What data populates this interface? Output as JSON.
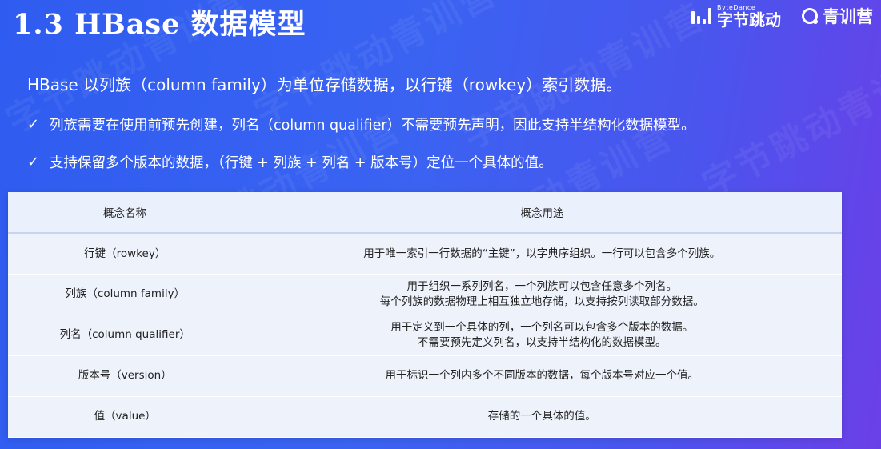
{
  "slide": {
    "title": "1.3 HBase 数据模型",
    "logos": {
      "bytedance_en": "ByteDance",
      "bytedance_cn": "字节跳动",
      "qingxunying": "青训营"
    },
    "watermark": "字节跳动青训营"
  },
  "content": {
    "intro": "HBase 以列族（column family）为单位存储数据，以行键（rowkey）索引数据。",
    "bullets": [
      "列族需要在使用前预先创建，列名（column qualifier）不需要预先声明，因此支持半结构化数据模型。",
      "支持保留多个版本的数据，（行键 + 列族 + 列名 + 版本号）定位一个具体的值。"
    ]
  },
  "table": {
    "headers": [
      "概念名称",
      "概念用途"
    ],
    "rows": [
      {
        "name": "行键（rowkey）",
        "usage": [
          "用于唯一索引一行数据的“主键”，以字典序组织。一行可以包含多个列族。"
        ]
      },
      {
        "name": "列族（column family）",
        "usage": [
          "用于组织一系列列名，一个列族可以包含任意多个列名。",
          "每个列族的数据物理上相互独立地存储，以支持按列读取部分数据。"
        ]
      },
      {
        "name": "列名（column qualifier）",
        "usage": [
          "用于定义到一个具体的列，一个列名可以包含多个版本的数据。",
          "不需要预先定义列名，以支持半结构化的数据模型。"
        ]
      },
      {
        "name": "版本号（version）",
        "usage": [
          "用于标识一个列内多个不同版本的数据，每个版本号对应一个值。"
        ]
      },
      {
        "name": "值（value）",
        "usage": [
          "存储的一个具体的值。"
        ]
      }
    ]
  },
  "icons": {
    "bullet": "check-icon"
  },
  "colors": {
    "background_start": "#2f5cf0",
    "background_end": "#6b3fe8",
    "table_header_bg": "#eaf0fc",
    "table_row_alt_bg": "#eef2fb"
  }
}
